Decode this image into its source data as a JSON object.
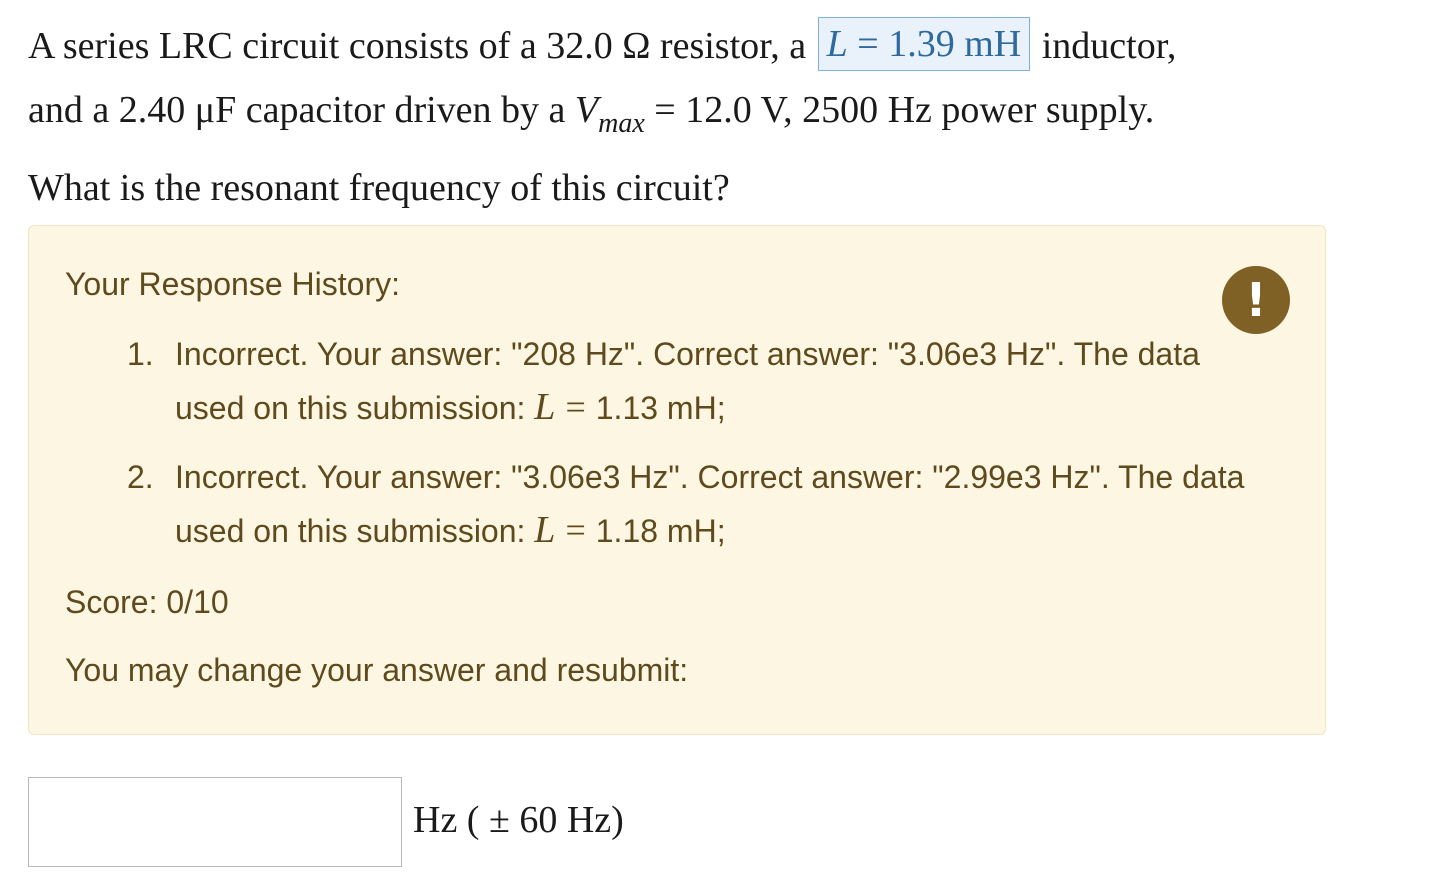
{
  "question": {
    "part1": "A series LRC circuit consists of a 32.0 Ω resistor, a",
    "inductance_var": "L",
    "inductance_eq": "=",
    "inductance_value": "1.39 mH",
    "part2": "inductor,",
    "part3": "and a 2.40 μF capacitor driven by a",
    "voltage_var": "V",
    "voltage_sub": "max",
    "part4": "= 12.0 V, 2500 Hz power supply.",
    "part5": "What is the resonant frequency of this circuit?"
  },
  "history": {
    "title": "Your Response History:",
    "alert_icon": "exclamation-icon",
    "alert_glyph": "!",
    "colors": {
      "panel_bg": "#fcf6e2",
      "text": "#5e4a1c",
      "icon_bg": "#7f6125",
      "highlight": "#2e6a9e"
    },
    "entries": [
      {
        "num": "1.",
        "text": "Incorrect. Your answer: \"208 Hz\". Correct answer: \"3.06e3 Hz\". The data used on this submission:",
        "var": "L",
        "eq": "=",
        "value": "1.13 mH;"
      },
      {
        "num": "2.",
        "text": "Incorrect. Your answer: \"3.06e3 Hz\". Correct answer: \"2.99e3 Hz\". The data used on this submission:",
        "var": "L",
        "eq": "=",
        "value": "1.18 mH;"
      }
    ],
    "score": "Score: 0/10",
    "resubmit": "You may change your answer and resubmit:"
  },
  "answer": {
    "value": "",
    "units": "Hz ( ± 60 Hz)"
  }
}
